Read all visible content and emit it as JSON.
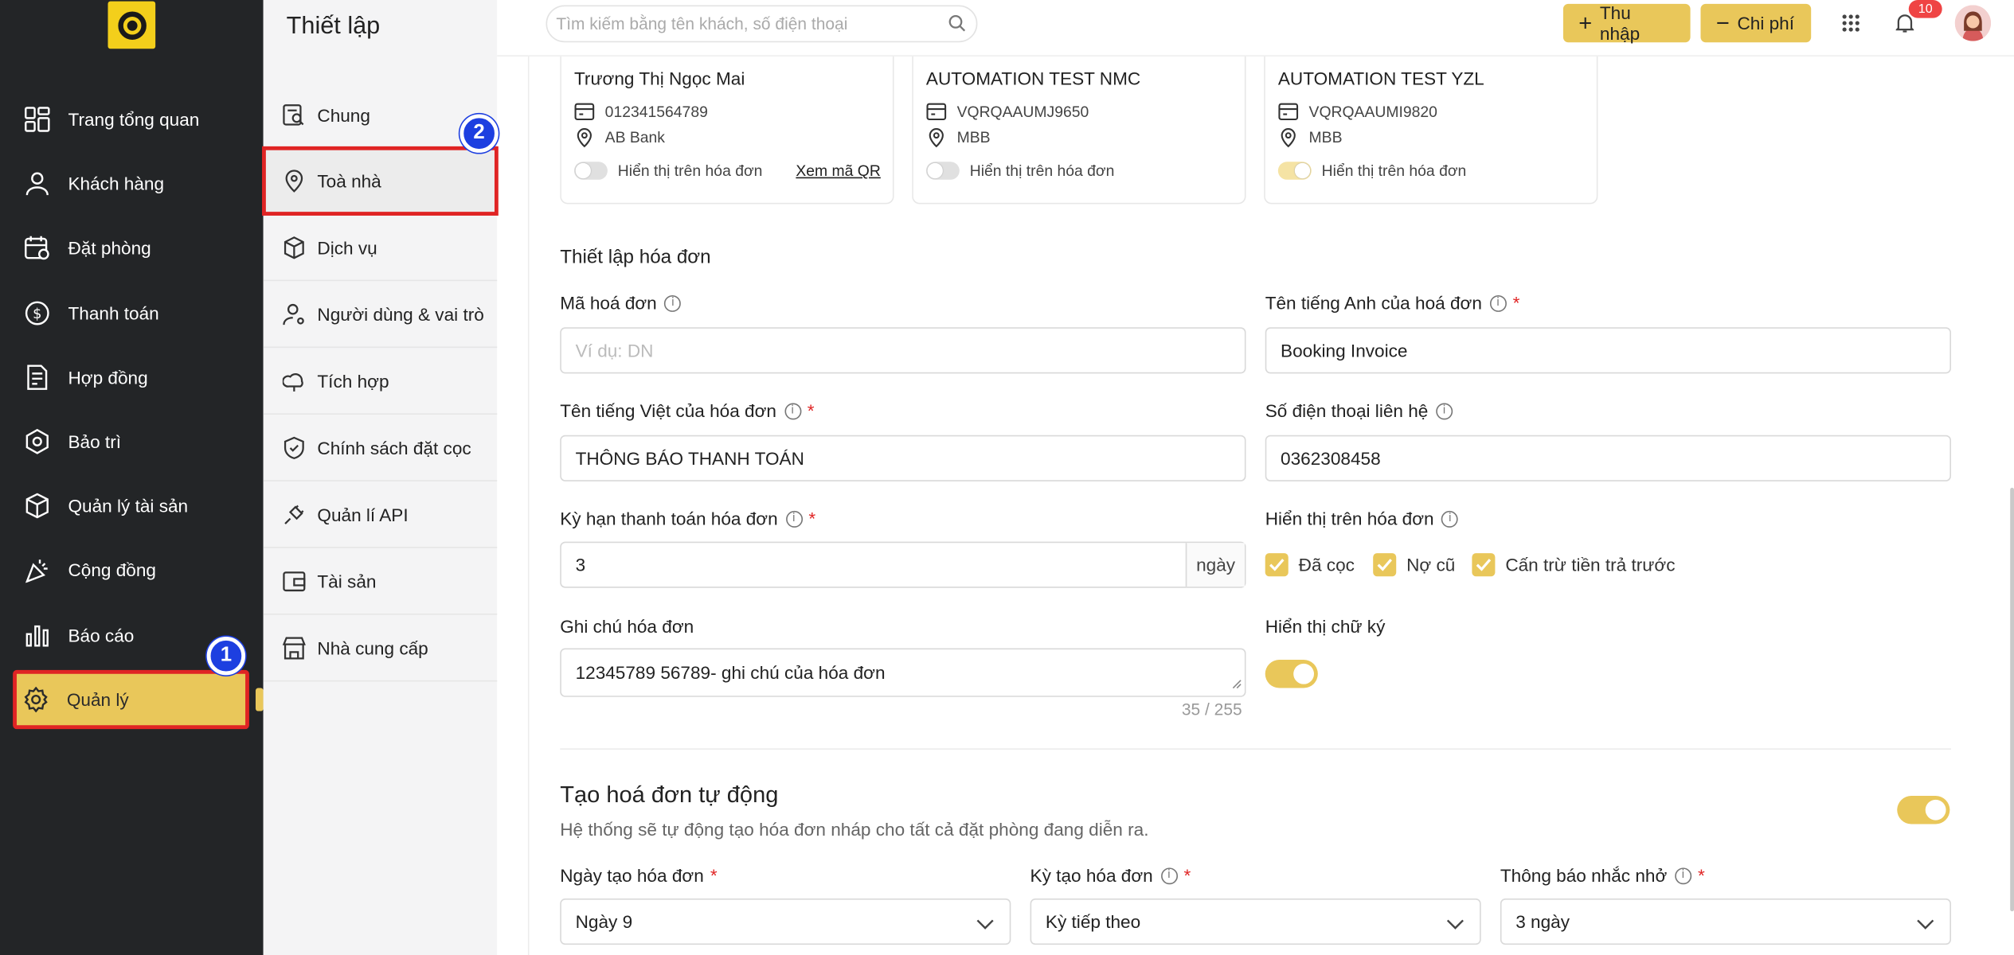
{
  "sidebar": {
    "items": [
      {
        "label": "Trang tổng quan",
        "icon": "dashboard-icon"
      },
      {
        "label": "Khách hàng",
        "icon": "user-icon"
      },
      {
        "label": "Đặt phòng",
        "icon": "calendar-icon"
      },
      {
        "label": "Thanh toán",
        "icon": "dollar-icon"
      },
      {
        "label": "Hợp đồng",
        "icon": "contract-icon"
      },
      {
        "label": "Bảo trì",
        "icon": "maintenance-icon"
      },
      {
        "label": "Quản lý tài sản",
        "icon": "box-icon"
      },
      {
        "label": "Cộng đồng",
        "icon": "celebration-icon"
      },
      {
        "label": "Báo cáo",
        "icon": "chart-icon"
      },
      {
        "label": "Quản lý",
        "icon": "gear-icon"
      }
    ],
    "step_marker": "1"
  },
  "settings": {
    "title": "Thiết lập",
    "items": [
      {
        "label": "Chung"
      },
      {
        "label": "Toà nhà"
      },
      {
        "label": "Dịch vụ"
      },
      {
        "label": "Người dùng & vai trò"
      },
      {
        "label": "Tích hợp"
      },
      {
        "label": "Chính sách đặt cọc"
      },
      {
        "label": "Quản lí API"
      },
      {
        "label": "Tài sản"
      },
      {
        "label": "Nhà cung cấp"
      }
    ],
    "step_marker": "2"
  },
  "topbar": {
    "search_placeholder": "Tìm kiếm bằng tên khách, số điện thoại",
    "income_label": "Thu nhập",
    "expense_label": "Chi phí",
    "notification_count": "10"
  },
  "bank_accounts": [
    {
      "name": "Trương Thị Ngọc Mai",
      "account": "012341564789",
      "bank": "AB Bank",
      "toggle_label": "Hiển thị trên hóa đơn",
      "shown": false,
      "qr_link": "Xem mã QR"
    },
    {
      "name": "AUTOMATION TEST NMC",
      "account": "VQRQAAUMJ9650",
      "bank": "MBB",
      "toggle_label": "Hiển thị trên hóa đơn",
      "shown": false
    },
    {
      "name": "AUTOMATION TEST YZL",
      "account": "VQRQAAUMI9820",
      "bank": "MBB",
      "toggle_label": "Hiển thị trên hóa đơn",
      "shown": true
    }
  ],
  "invoice_settings": {
    "title": "Thiết lập hóa đơn",
    "code_label": "Mã hoá đơn",
    "code_placeholder": "Ví dụ: DN",
    "english_name_label": "Tên tiếng Anh của hoá đơn",
    "english_name_value": "Booking Invoice",
    "vietnamese_name_label": "Tên tiếng Việt của hóa đơn",
    "vietnamese_name_value": "THÔNG BÁO THANH TOÁN",
    "phone_label": "Số điện thoại liên hệ",
    "phone_value": "0362308458",
    "term_label": "Kỳ hạn thanh toán hóa đơn",
    "term_value": "3",
    "term_unit": "ngày",
    "display_label": "Hiển thị trên hóa đơn",
    "display_options": [
      "Đã cọc",
      "Nợ cũ",
      "Cấn trừ tiền trả trước"
    ],
    "note_label": "Ghi chú hóa đơn",
    "note_value": "12345789 56789- ghi chú của hóa đơn",
    "note_counter": "35 / 255",
    "signature_label": "Hiển thị chữ ký",
    "signature_enabled": true
  },
  "auto_invoice": {
    "title": "Tạo hoá đơn tự động",
    "description": "Hệ thống sẽ tự động tạo hóa đơn nháp cho tất cả đặt phòng đang diễn ra.",
    "enabled": true,
    "create_day_label": "Ngày tạo hóa đơn",
    "create_day_value": "Ngày 9",
    "period_label": "Kỳ tạo hóa đơn",
    "period_value": "Kỳ tiếp theo",
    "reminder_label": "Thông báo nhắc nhở",
    "reminder_value": "3 ngày"
  },
  "colors": {
    "accent": "#e9c75a",
    "sidebar_bg": "#232527",
    "highlight": "#e02424",
    "marker": "#1d3fe0"
  }
}
